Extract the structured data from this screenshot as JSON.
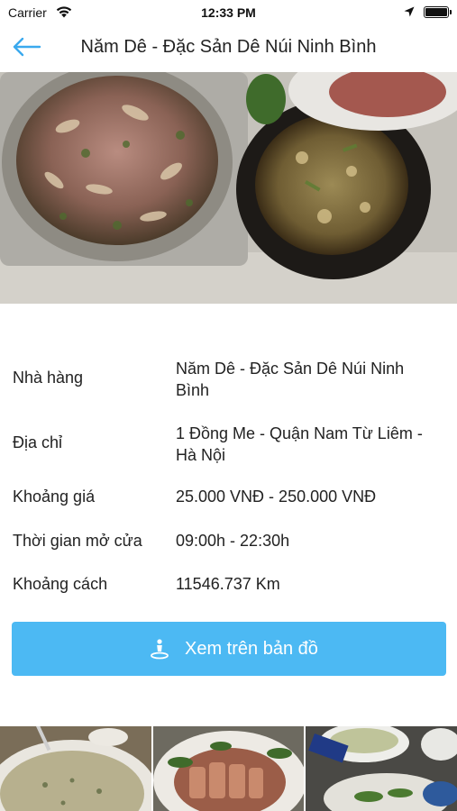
{
  "status_bar": {
    "carrier": "Carrier",
    "time": "12:33 PM",
    "wifi_icon": "wifi-icon",
    "location_icon": "location-arrow-icon",
    "battery_icon": "battery-icon",
    "battery_level": 1.0
  },
  "nav": {
    "back_icon": "arrow-left-icon",
    "title": "Năm Dê - Đặc Sản Dê Núi Ninh Bình"
  },
  "hero": {
    "image": "food-photo"
  },
  "details": [
    {
      "label": "Nhà hàng",
      "value": "Năm Dê - Đặc Sản Dê Núi Ninh Bình"
    },
    {
      "label": "Địa chỉ",
      "value": "1 Đồng Me - Quận Nam Từ Liêm - Hà Nội"
    },
    {
      "label": "Khoảng giá",
      "value": "25.000 VNĐ - 250.000 VNĐ"
    },
    {
      "label": "Thời gian mở cửa",
      "value": "09:00h - 22:30h"
    },
    {
      "label": "Khoảng cách",
      "value": "11546.737 Km"
    }
  ],
  "map_button": {
    "label": "Xem trên bản đồ",
    "icon": "person-pin-icon"
  },
  "gallery": {
    "images": [
      "food-photo",
      "food-photo",
      "food-photo"
    ]
  },
  "colors": {
    "accent": "#4cb9f3",
    "back_arrow": "#3aa9ee",
    "text": "#222222"
  }
}
